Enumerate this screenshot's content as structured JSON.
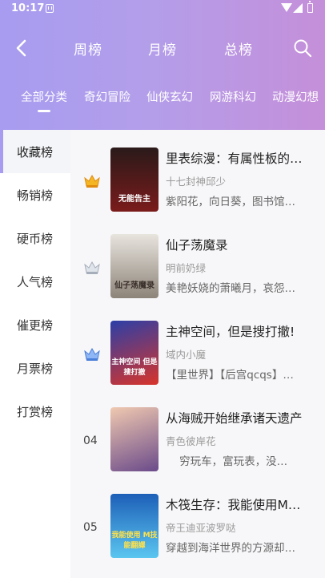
{
  "status_bar": {
    "time": "10:17"
  },
  "header": {
    "tabs": [
      {
        "label": "周榜"
      },
      {
        "label": "月榜"
      },
      {
        "label": "总榜"
      }
    ],
    "categories": [
      {
        "label": "全部分类",
        "active": true
      },
      {
        "label": "奇幻冒险"
      },
      {
        "label": "仙侠玄幻"
      },
      {
        "label": "网游科幻"
      },
      {
        "label": "动漫幻想"
      }
    ]
  },
  "sidebar": {
    "items": [
      {
        "label": "收藏榜",
        "active": true
      },
      {
        "label": "畅销榜"
      },
      {
        "label": "硬币榜"
      },
      {
        "label": "人气榜"
      },
      {
        "label": "催更榜"
      },
      {
        "label": "月票榜"
      },
      {
        "label": "打赏榜"
      }
    ]
  },
  "books": [
    {
      "rank": "1",
      "rank_icon": "gold-crown-icon",
      "title": "里表综漫：有属性板的…",
      "author": "十七封神邱少",
      "desc": "紫阳花，向日葵，图书馆…",
      "cover_text": "无能告主",
      "cover_colors": [
        "#2a1a1a",
        "#7a1b1b"
      ]
    },
    {
      "rank": "2",
      "rank_icon": "silver-crown-icon",
      "title": "仙子荡魔录",
      "author": "明前奶绿",
      "desc": "美艳妖娆的萧曦月，哀怨…",
      "cover_text": "仙子荡魔录",
      "cover_colors": [
        "#e8e4de",
        "#8d8479"
      ]
    },
    {
      "rank": "3",
      "rank_icon": "blue-crown-icon",
      "title": "主神空间，但是搜打撤!",
      "author": "域内小魔",
      "desc": "【里世界】【后宫qcqs】…",
      "cover_text": "主神空间 但是搜打撤",
      "cover_colors": [
        "#2b3fa8",
        "#d8342a"
      ]
    },
    {
      "rank": "04",
      "title": "从海贼开始继承诸天遗产",
      "author": "青色彼岸花",
      "desc": "    穷玩车，富玩表，没…",
      "cover_text": "",
      "cover_colors": [
        "#f0c9b0",
        "#6a4a8a"
      ]
    },
    {
      "rank": "05",
      "title": "木筏生存：我能使用M…",
      "author": "帝王迪亚波罗哒",
      "desc": "穿越到海洋世界的方源却…",
      "cover_text": "我能使用 M技能翻譯",
      "cover_colors": [
        "#1d5fb8",
        "#5bc6f0"
      ]
    }
  ]
}
